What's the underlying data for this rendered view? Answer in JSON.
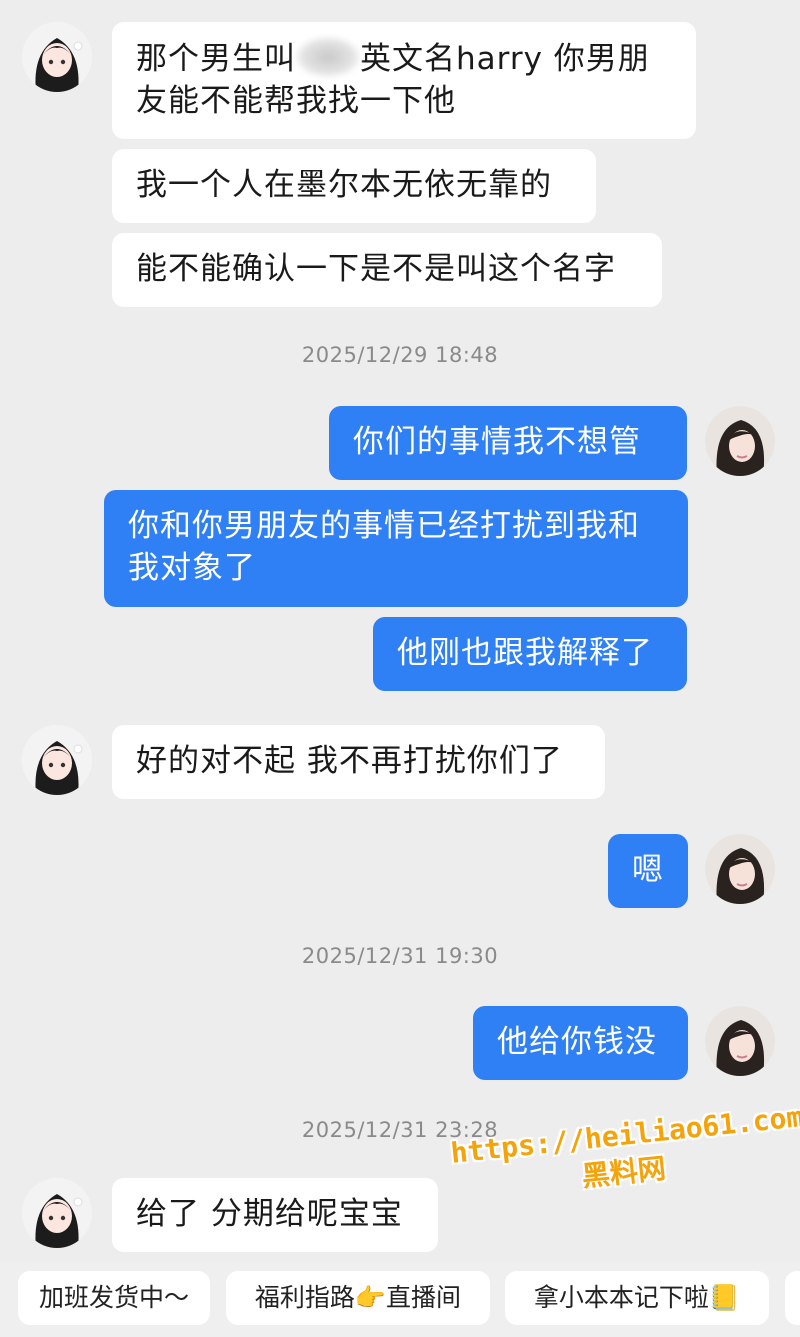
{
  "messages": {
    "m1_before": "那个男生叫",
    "m1_after": "英文名harry 你男朋",
    "m1_line2": "友能不能帮我找一下他",
    "m2": "我一个人在墨尔本无依无靠的",
    "m3": "能不能确认一下是不是叫这个名字",
    "t1": "2025/12/29 18:48",
    "m4": "你们的事情我不想管",
    "m5_line1": "你和你男朋友的事情已经打扰到我和",
    "m5_line2": "我对象了",
    "m6": "他刚也跟我解释了",
    "m7": "好的对不起 我不再打扰你们了",
    "m8": "嗯",
    "t2": "2025/12/31 19:30",
    "m9": "他给你钱没",
    "t3": "2025/12/31 23:28",
    "m10": "给了 分期给呢宝宝"
  },
  "quick_replies": [
    "加班发货中～",
    "福利指路👉直播间",
    "拿小本本记下啦📒"
  ],
  "watermark": {
    "line1": "https://heiliao61.com",
    "line2": "黑料网"
  },
  "colors": {
    "outgoing_bubble": "#2f7ff5",
    "incoming_bubble": "#ffffff",
    "background": "#ededed"
  }
}
